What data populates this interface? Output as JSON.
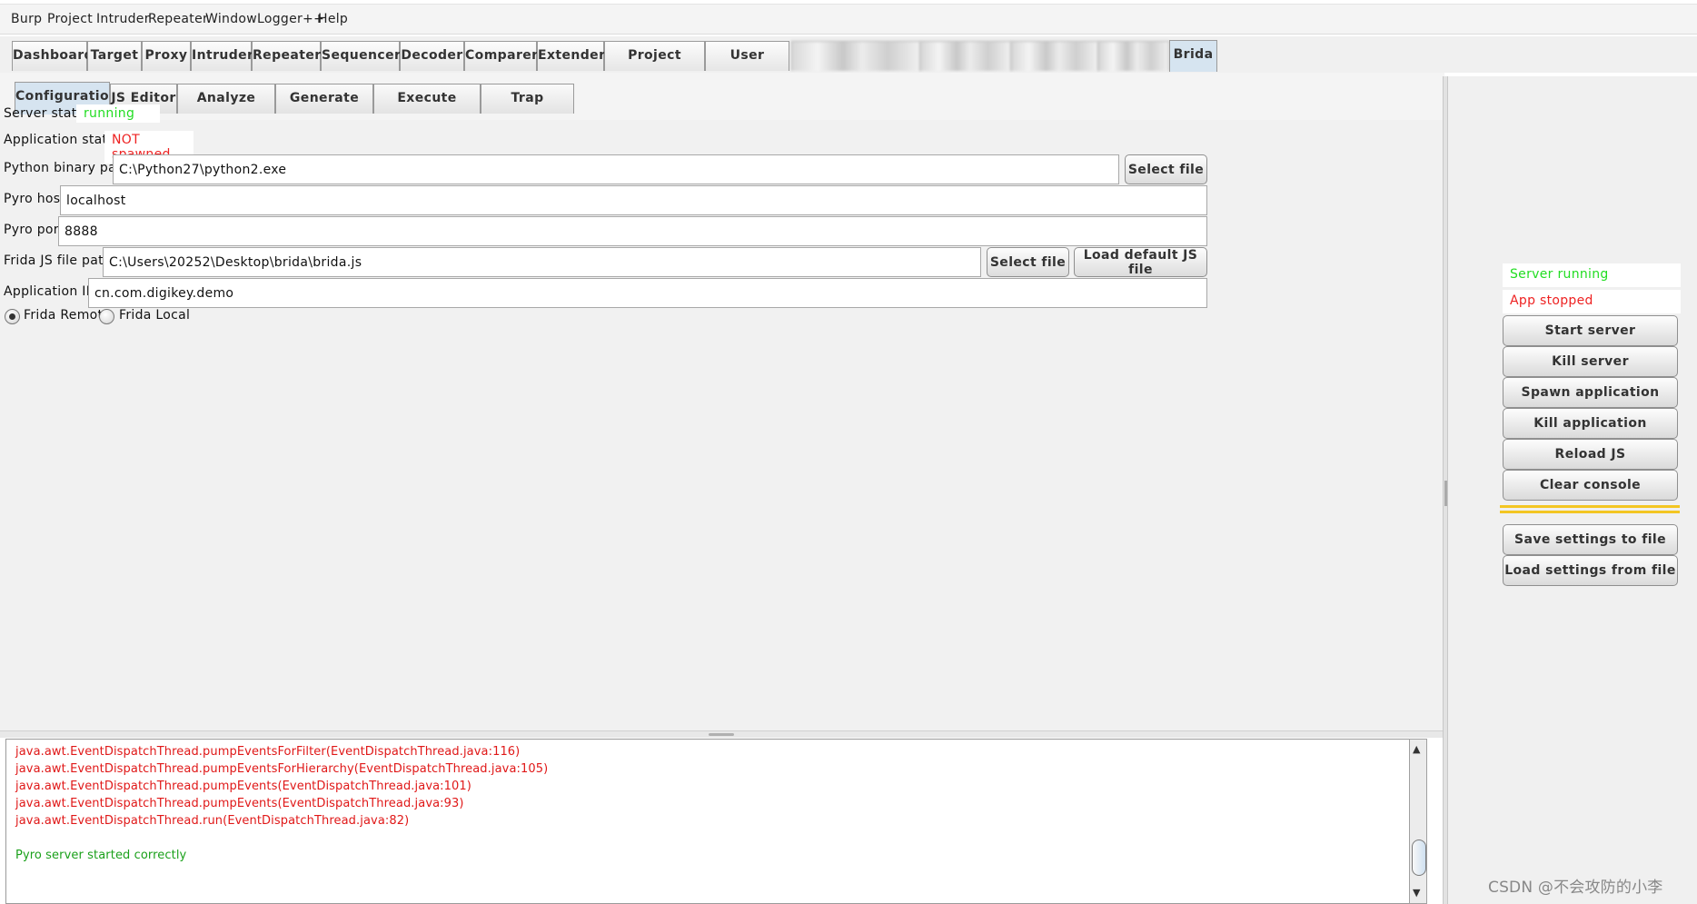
{
  "menubar": {
    "items": [
      "Burp",
      "Project",
      "Intruder",
      "Repeater",
      "Window",
      "Logger++",
      "Help"
    ]
  },
  "main_tabs": {
    "items": [
      "Dashboard",
      "Target",
      "Proxy",
      "Intruder",
      "Repeater",
      "Sequencer",
      "Decoder",
      "Comparer",
      "Extender",
      "Project options",
      "User options"
    ],
    "active": "Brida"
  },
  "sub_tabs": {
    "items": [
      "Configurations",
      "JS Editor",
      "Analyze binary",
      "Generate stubs",
      "Execute method",
      "Trap methods"
    ],
    "active_index": 0
  },
  "config": {
    "server_status_label": "Server status:",
    "server_status_value": "running",
    "app_status_label": "Application status:",
    "app_status_value": "NOT spawned",
    "python_path_label": "Python binary path:",
    "python_path_value": "C:\\Python27\\python2.exe",
    "select_file_label": "Select file",
    "pyro_host_label": "Pyro host:",
    "pyro_host_value": "localhost",
    "pyro_port_label": "Pyro port:",
    "pyro_port_value": "8888",
    "frida_js_label": "Frida JS file path:",
    "frida_js_value": "C:\\Users\\20252\\Desktop\\brida\\brida.js",
    "load_default_js_label": "Load default JS file",
    "app_id_label": "Application ID:",
    "app_id_value": "cn.com.digikey.demo",
    "frida_remote_label": "Frida Remote",
    "frida_local_label": "Frida Local",
    "selected_mode": "Frida Remote"
  },
  "console": {
    "lines": [
      "java.awt.EventDispatchThread.pumpEventsForFilter(EventDispatchThread.java:116)",
      "java.awt.EventDispatchThread.pumpEventsForHierarchy(EventDispatchThread.java:105)",
      "java.awt.EventDispatchThread.pumpEvents(EventDispatchThread.java:101)",
      "java.awt.EventDispatchThread.pumpEvents(EventDispatchThread.java:93)",
      "java.awt.EventDispatchThread.run(EventDispatchThread.java:82)"
    ],
    "success_line": "Pyro server started correctly",
    "scroll_up_glyph": "▲",
    "scroll_down_glyph": "▼"
  },
  "side_panel": {
    "server_status": "Server running",
    "app_status": "App stopped",
    "buttons": [
      "Start server",
      "Kill server",
      "Spawn application",
      "Kill application",
      "Reload JS",
      "Clear console"
    ],
    "buttons_after_separator": [
      "Save settings to file",
      "Load settings from file"
    ]
  },
  "watermark": "CSDN @不会攻防的小李",
  "colors": {
    "status_ok": "#22dd22",
    "status_error": "#ee2222",
    "console_error": "#e01818",
    "console_ok": "#1aa01a",
    "separator": "#f3c623",
    "active_tab": "#d6e4f0"
  }
}
